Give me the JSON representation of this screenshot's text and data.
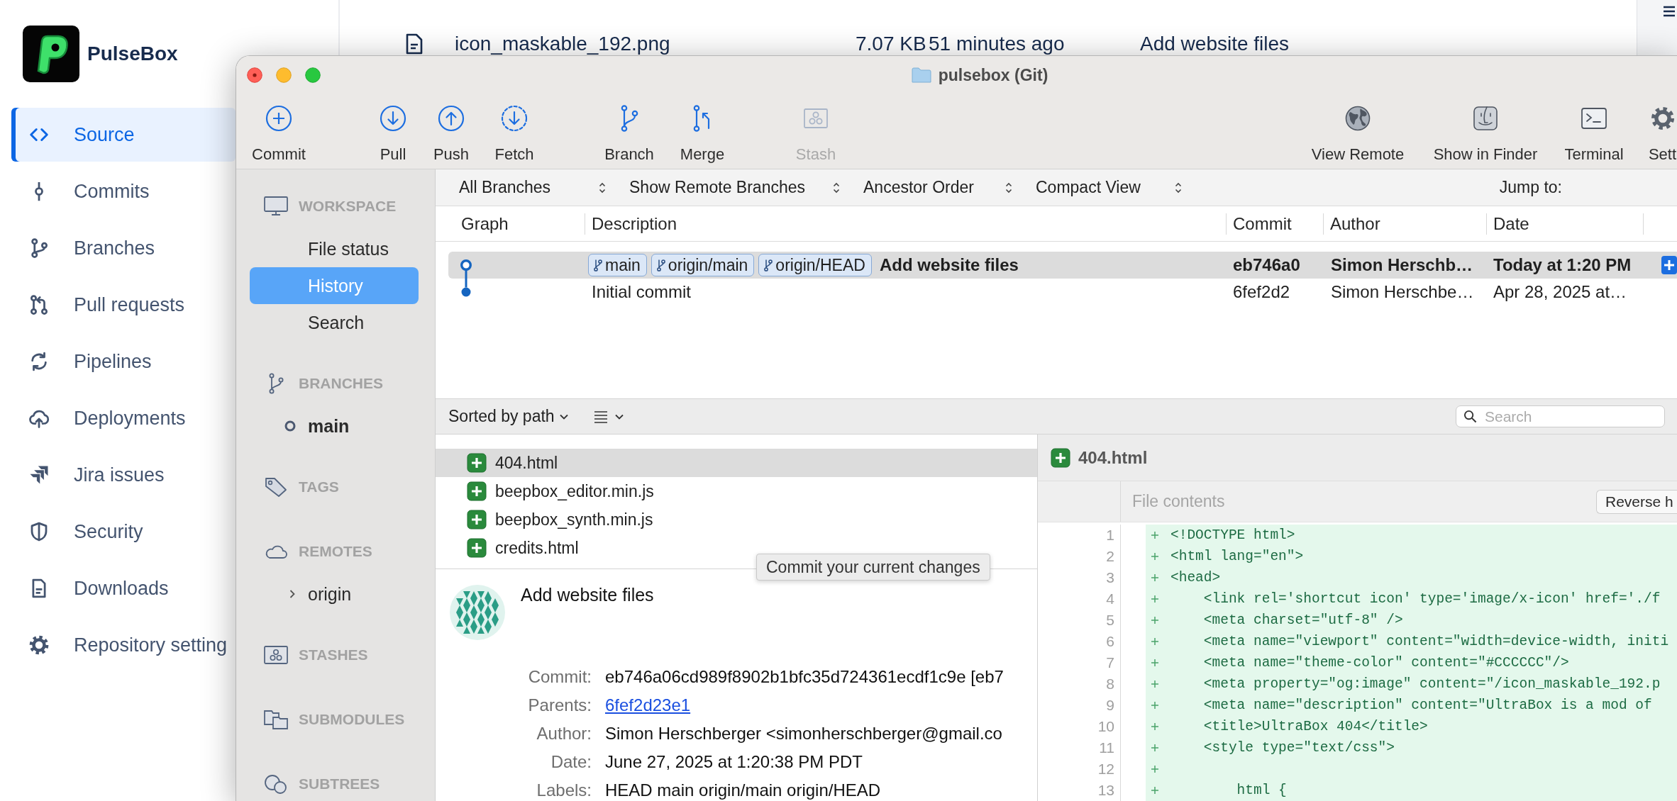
{
  "web_page": {
    "brand": {
      "name": "PulseBox"
    },
    "nav": [
      {
        "label": "Source",
        "selected": true
      },
      {
        "label": "Commits",
        "selected": false
      },
      {
        "label": "Branches",
        "selected": false
      },
      {
        "label": "Pull requests",
        "selected": false
      },
      {
        "label": "Pipelines",
        "selected": false
      },
      {
        "label": "Deployments",
        "selected": false
      },
      {
        "label": "Jira issues",
        "selected": false
      },
      {
        "label": "Security",
        "selected": false
      },
      {
        "label": "Downloads",
        "selected": false
      },
      {
        "label": "Repository setting",
        "selected": false
      }
    ],
    "file_row": {
      "name": "icon_maskable_192.png",
      "size": "7.07 KB",
      "modified": "51 minutes ago",
      "message": "Add website files"
    }
  },
  "window": {
    "title": "pulsebox (Git)"
  },
  "toolbar": {
    "left": [
      {
        "label": "Commit",
        "disabled": false
      },
      {
        "label": "Pull",
        "disabled": false
      },
      {
        "label": "Push",
        "disabled": false
      },
      {
        "label": "Fetch",
        "disabled": false
      },
      {
        "label": "Branch",
        "disabled": false
      },
      {
        "label": "Merge",
        "disabled": false
      },
      {
        "label": "Stash",
        "disabled": true
      }
    ],
    "right": [
      {
        "label": "View Remote"
      },
      {
        "label": "Show in Finder"
      },
      {
        "label": "Terminal"
      },
      {
        "label": "Sett"
      }
    ]
  },
  "sidebar": {
    "sections": [
      {
        "title": "WORKSPACE",
        "items": [
          {
            "kind": "view",
            "label": "File status",
            "selected": false
          },
          {
            "kind": "view",
            "label": "History",
            "selected": true
          },
          {
            "kind": "view",
            "label": "Search",
            "selected": false
          }
        ]
      },
      {
        "title": "BRANCHES",
        "items": [
          {
            "kind": "branch",
            "label": "main",
            "selected": false,
            "current": true
          }
        ]
      },
      {
        "title": "TAGS"
      },
      {
        "title": "REMOTES",
        "items": [
          {
            "kind": "remote",
            "label": "origin",
            "selected": false,
            "expanded": false
          }
        ]
      },
      {
        "title": "STASHES"
      },
      {
        "title": "SUBMODULES"
      },
      {
        "title": "SUBTREES"
      }
    ]
  },
  "filters": {
    "dropdowns": [
      {
        "label": "All Branches"
      },
      {
        "label": "Show Remote Branches"
      },
      {
        "label": "Ancestor Order"
      },
      {
        "label": "Compact View"
      }
    ],
    "jump_label": "Jump to:"
  },
  "commits": {
    "columns": [
      "Graph",
      "Description",
      "Commit",
      "Author",
      "Date"
    ],
    "rows": [
      {
        "selected": true,
        "head": true,
        "refs": [
          "main",
          "origin/main",
          "origin/HEAD"
        ],
        "message": "Add website files",
        "hash": "eb746a0",
        "author": "Simon Herschb…",
        "date": "Today at 1:20 PM"
      },
      {
        "selected": false,
        "head": false,
        "message": "Initial commit",
        "hash": "6fef2d2",
        "author": "Simon Herschbe…",
        "date": "Apr 28, 2025 at…"
      }
    ]
  },
  "file_list": {
    "sort_label": "Sorted by path",
    "search": {
      "placeholder": "Search"
    },
    "files": [
      {
        "name": "404.html",
        "kind": "added",
        "selected": true
      },
      {
        "name": "beepbox_editor.min.js",
        "kind": "added",
        "selected": false
      },
      {
        "name": "beepbox_synth.min.js",
        "kind": "added",
        "selected": false
      },
      {
        "name": "credits.html",
        "kind": "added",
        "selected": false
      }
    ]
  },
  "commit_details": {
    "subject": "Add website files",
    "fields": [
      {
        "label": "Commit:",
        "value": "eb746a06cd989f8902b1bfc35d724361ecdf1c9e [eb7",
        "kind": "text"
      },
      {
        "label": "Parents:",
        "value": "6fef2d23e1",
        "kind": "link"
      },
      {
        "label": "Author:",
        "value": "Simon Herschberger <simonherschberger@gmail.co",
        "kind": "text"
      },
      {
        "label": "Date:",
        "value": "June 27, 2025 at 1:20:38 PM PDT",
        "kind": "text"
      },
      {
        "label": "Labels:",
        "value": "HEAD main origin/main origin/HEAD",
        "kind": "text"
      }
    ]
  },
  "tooltip": {
    "text": "Commit your current changes"
  },
  "diff": {
    "file": {
      "name": "404.html",
      "kind": "added"
    },
    "section_label": "File contents",
    "action_label": "Reverse h",
    "lines": [
      {
        "number": "1",
        "kind": "added",
        "text": "<!DOCTYPE html>"
      },
      {
        "number": "2",
        "kind": "added",
        "text": "<html lang=\"en\">"
      },
      {
        "number": "3",
        "kind": "added",
        "text": "<head>"
      },
      {
        "number": "4",
        "kind": "added",
        "text": "    <link rel='shortcut icon' type='image/x-icon' href='./f"
      },
      {
        "number": "5",
        "kind": "added",
        "text": "    <meta charset=\"utf-8\" />"
      },
      {
        "number": "6",
        "kind": "added",
        "text": "    <meta name=\"viewport\" content=\"width=device-width, initi"
      },
      {
        "number": "7",
        "kind": "added",
        "text": "    <meta name=\"theme-color\" content=\"#CCCCCC\"/>"
      },
      {
        "number": "8",
        "kind": "added",
        "text": "    <meta property=\"og:image\" content=\"/icon_maskable_192.p"
      },
      {
        "number": "9",
        "kind": "added",
        "text": "    <meta name=\"description\" content=\"UltraBox is a mod of"
      },
      {
        "number": "10",
        "kind": "added",
        "text": "    <title>UltraBox 404</title>"
      },
      {
        "number": "11",
        "kind": "added",
        "text": "    <style type=\"text/css\">"
      },
      {
        "number": "12",
        "kind": "added"
      },
      {
        "number": "13",
        "kind": "added",
        "text": "        html {"
      }
    ]
  }
}
